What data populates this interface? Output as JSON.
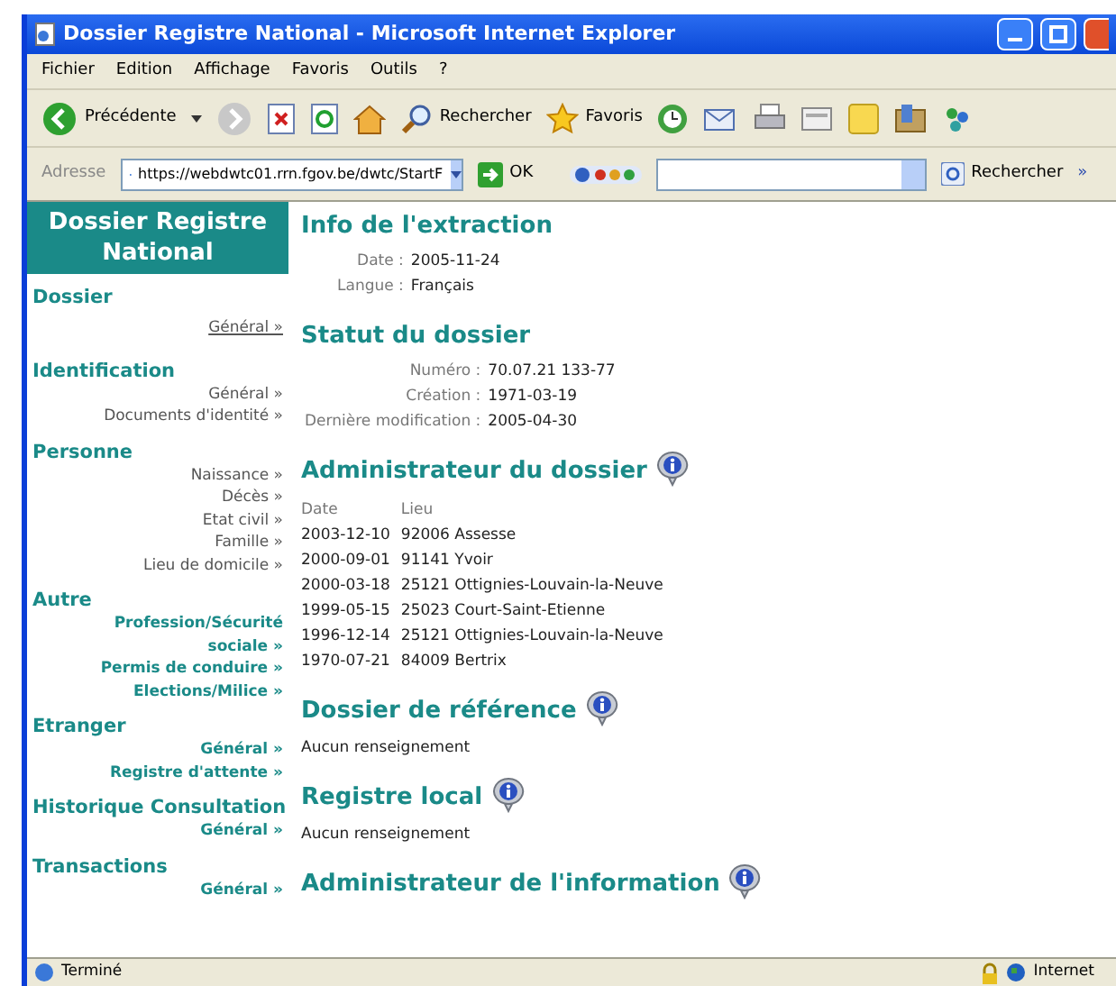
{
  "window": {
    "title": "Dossier Registre National - Microsoft Internet Explorer"
  },
  "menu": [
    "Fichier",
    "Edition",
    "Affichage",
    "Favoris",
    "Outils",
    "?"
  ],
  "toolbar": {
    "back": "Précédente",
    "search": "Rechercher",
    "favorites": "Favoris"
  },
  "address_bar": {
    "label": "Adresse",
    "url": "https://webdwtc01.rrn.fgov.be/dwtc/StartF",
    "go": "OK",
    "google_search": "Rechercher",
    "more": "»"
  },
  "sidebar": {
    "title": "Dossier Registre National",
    "sections": [
      {
        "title": "Dossier",
        "items": [
          {
            "label": "Général »",
            "selected": true
          }
        ]
      },
      {
        "title": "Identification",
        "items": [
          {
            "label": "Général »",
            "selected": false
          },
          {
            "label": "Documents d'identité »",
            "selected": false
          }
        ]
      },
      {
        "title": "Personne",
        "items": [
          {
            "label": "Naissance »",
            "selected": false
          },
          {
            "label": "Décès »",
            "selected": false
          },
          {
            "label": "Etat civil »",
            "selected": false
          },
          {
            "label": "Famille »",
            "selected": false
          },
          {
            "label": "Lieu de domicile »",
            "selected": false
          }
        ]
      },
      {
        "title": "Autre",
        "items": [
          {
            "label": "Profession/Sécurité sociale »",
            "selected": false
          },
          {
            "label": "Permis de conduire »",
            "selected": false
          },
          {
            "label": "Elections/Milice »",
            "selected": false
          }
        ]
      },
      {
        "title": "Etranger",
        "items": [
          {
            "label": "Général »",
            "selected": false
          },
          {
            "label": "Registre d'attente »",
            "selected": false
          }
        ]
      },
      {
        "title": "Historique Consultation",
        "items": [
          {
            "label": "Général »",
            "selected": false
          }
        ]
      },
      {
        "title": "Transactions",
        "items": [
          {
            "label": "Général »",
            "selected": false
          }
        ]
      }
    ]
  },
  "sections": [
    {
      "kind": "fields",
      "title": "Info de l'extraction",
      "info": false,
      "fields": [
        {
          "label": "Date :",
          "value": "2005-11-24"
        },
        {
          "label": "Langue :",
          "value": "Français"
        }
      ]
    },
    {
      "kind": "fields",
      "title": "Statut du dossier",
      "info": false,
      "fields": [
        {
          "label": "Numéro :",
          "value": "70.07.21 133-77"
        },
        {
          "label": "Création :",
          "value": "1971-03-19"
        },
        {
          "label": "Dernière modification :",
          "value": "2005-04-30"
        }
      ]
    },
    {
      "kind": "table",
      "title": "Administrateur du dossier",
      "info": true,
      "columns": [
        "Date",
        "Lieu"
      ],
      "rows": [
        [
          "2003-12-10",
          "92006 Assesse"
        ],
        [
          "2000-09-01",
          "91141 Yvoir"
        ],
        [
          "2000-03-18",
          "25121 Ottignies-Louvain-la-Neuve"
        ],
        [
          "1999-05-15",
          "25023 Court-Saint-Etienne"
        ],
        [
          "1996-12-14",
          "25121 Ottignies-Louvain-la-Neuve"
        ],
        [
          "1970-07-21",
          "84009 Bertrix"
        ]
      ]
    },
    {
      "kind": "text",
      "title": "Dossier de référence",
      "info": true,
      "text": "Aucun renseignement"
    },
    {
      "kind": "text",
      "title": "Registre local",
      "info": true,
      "text": "Aucun renseignement"
    },
    {
      "kind": "text",
      "title": "Administrateur de l'information",
      "info": true
    }
  ],
  "status_bar": {
    "text": "Terminé",
    "zone": "Internet"
  }
}
